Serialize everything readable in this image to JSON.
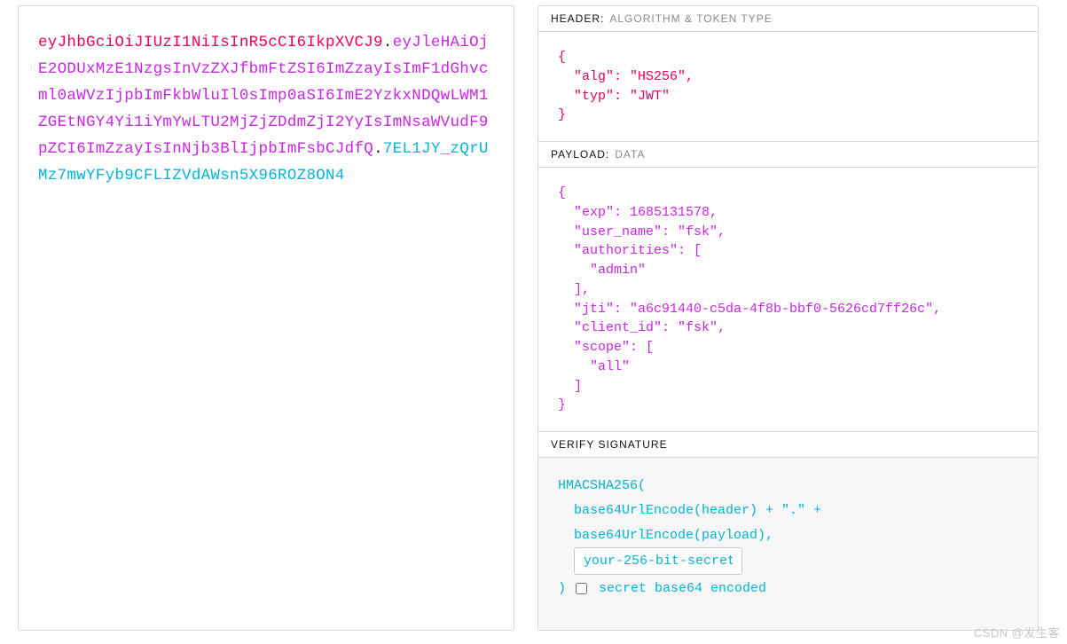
{
  "token": {
    "header_segment": "eyJhbGciOiJIUzI1NiIsInR5cCI6IkpXVCJ9",
    "payload_segment": "eyJleHAiOjE2ODUxMzE1NzgsInVzZXJfbmFtZSI6ImZzayIsImF1dGhvcml0aWVzIjpbImFkbWluIl0sImp0aSI6ImE2YzkxNDQwLWM1ZGEtNGY4Yi1iYmYwLTU2MjZjZDdmZjI2YyIsImNsaWVudF9pZCI6ImZzayIsInNjb3BlIjpbImFsbCJdfQ",
    "signature_segment": "7EL1JY_zQrUMz7mwYFyb9CFLIZVdAWsn5X96ROZ8ON4",
    "dot": "."
  },
  "sections": {
    "header": {
      "title": "HEADER:",
      "sub": "ALGORITHM & TOKEN TYPE"
    },
    "payload": {
      "title": "PAYLOAD:",
      "sub": "DATA"
    },
    "verify": {
      "title": "VERIFY SIGNATURE"
    }
  },
  "decoded": {
    "header_json": "{\n  \"alg\": \"HS256\",\n  \"typ\": \"JWT\"\n}",
    "payload_json": "{\n  \"exp\": 1685131578,\n  \"user_name\": \"fsk\",\n  \"authorities\": [\n    \"admin\"\n  ],\n  \"jti\": \"a6c91440-c5da-4f8b-bbf0-5626cd7ff26c\",\n  \"client_id\": \"fsk\",\n  \"scope\": [\n    \"all\"\n  ]\n}"
  },
  "verify": {
    "fn": "HMACSHA256(",
    "line1": "base64UrlEncode(header) + \".\" +",
    "line2": "base64UrlEncode(payload),",
    "secret_value": "your-256-bit-secret",
    "close": ") ",
    "checkbox_label": "secret base64 encoded",
    "checked": false
  },
  "watermark": "CSDN @发生客"
}
